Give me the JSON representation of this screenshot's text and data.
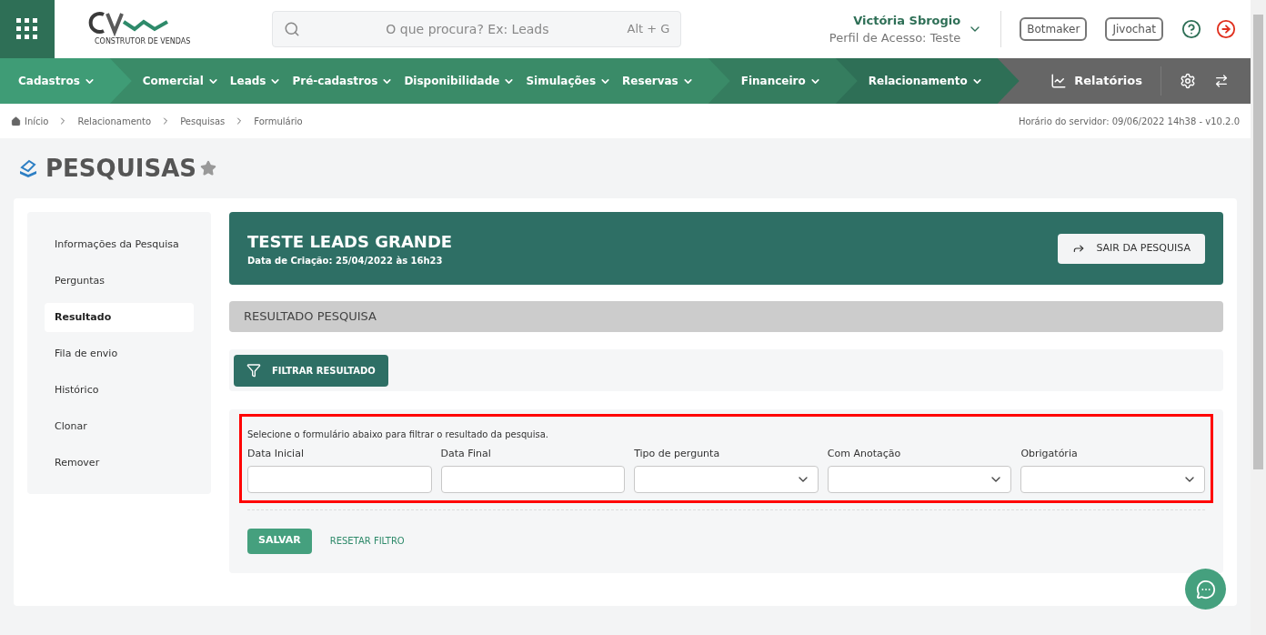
{
  "header": {
    "logo_tagline": "CONSTRUTOR DE VENDAS",
    "search_placeholder": "O que procura? Ex: Leads",
    "search_shortcut": "Alt + G",
    "user_name": "Victória Sbrogio",
    "user_profile": "Perfil de Acesso: Teste",
    "buttons": [
      "Botmaker",
      "Jivochat"
    ]
  },
  "nav": {
    "segments": [
      {
        "items": [
          "Cadastros"
        ]
      },
      {
        "items": [
          "Comercial",
          "Leads",
          "Pré-cadastros",
          "Disponibilidade",
          "Simulações",
          "Reservas"
        ]
      },
      {
        "items": [
          "Financeiro"
        ]
      },
      {
        "items": [
          "Relacionamento"
        ]
      }
    ],
    "reports": "Relatórios"
  },
  "breadcrumb": [
    "Início",
    "Relacionamento",
    "Pesquisas",
    "Formulário"
  ],
  "server_time": "Horário do servidor: 09/06/2022 14h38 - v10.2.0",
  "page_title": "PESQUISAS",
  "sidebar": {
    "items": [
      {
        "label": "Informações da Pesquisa",
        "selected": false
      },
      {
        "label": "Perguntas",
        "selected": false
      },
      {
        "label": "Resultado",
        "selected": true
      },
      {
        "label": "Fila de envio",
        "selected": false
      },
      {
        "label": "Histórico",
        "selected": false
      },
      {
        "label": "Clonar",
        "selected": false
      },
      {
        "label": "Remover",
        "selected": false
      }
    ]
  },
  "survey": {
    "title": "TESTE LEADS GRANDE",
    "created": "Data de Criação: 25/04/2022 às 16h23",
    "exit_button": "SAIR DA PESQUISA"
  },
  "section_title": "RESULTADO PESQUISA",
  "filter_button": "FILTRAR RESULTADO",
  "filter_form": {
    "hint": "Selecione o formulário abaixo para filtrar o resultado da pesquisa.",
    "fields": [
      {
        "label": "Data Inicial",
        "kind": "input"
      },
      {
        "label": "Data Final",
        "kind": "input"
      },
      {
        "label": "Tipo de pergunta",
        "kind": "select"
      },
      {
        "label": "Com Anotação",
        "kind": "select"
      },
      {
        "label": "Obrigatória",
        "kind": "select"
      }
    ],
    "save_button": "SALVAR",
    "reset_link": "RESETAR FILTRO"
  }
}
